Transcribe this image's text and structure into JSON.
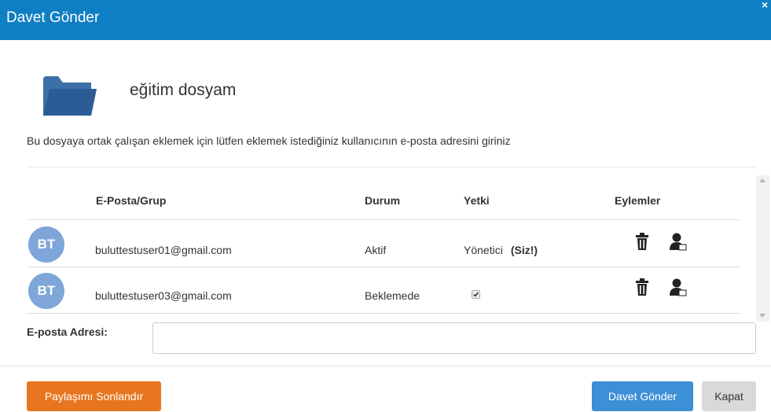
{
  "header": {
    "title": "Davet Gönder",
    "close_glyph": "×"
  },
  "folder": {
    "icon": "folder-icon",
    "name": "eğitim dosyam"
  },
  "instructions": "Bu dosyaya ortak çalışan eklemek için lütfen eklemek istediğiniz kullanıcının e-posta adresini giriniz",
  "table": {
    "columns": {
      "email": "E-Posta/Grup",
      "status": "Durum",
      "permission": "Yetki",
      "actions": "Eylemler"
    },
    "rows": [
      {
        "initials": "BT",
        "email": "buluttestuser01@gmail.com",
        "status": "Aktif",
        "permission": "Yönetici",
        "you_label": "(Siz!)",
        "checkbox": false,
        "actions": [
          "trash-icon",
          "user-permission-icon"
        ]
      },
      {
        "initials": "BT",
        "email": "buluttestuser03@gmail.com",
        "status": "Beklemede",
        "permission": "",
        "checkbox": true,
        "checked": true,
        "actions": [
          "trash-icon",
          "user-permission-icon"
        ]
      }
    ]
  },
  "email_field": {
    "label": "E-posta Adresi:",
    "value": "",
    "placeholder": ""
  },
  "buttons": {
    "end_sharing": "Paylaşımı Sonlandır",
    "send_invite": "Davet Gönder",
    "close": "Kapat"
  },
  "colors": {
    "header": "#0f7fc4",
    "avatar": "#7ea6d8",
    "end_sharing": "#e8761f",
    "send_invite": "#3d8fd6",
    "close": "#d9d9d9",
    "folder": "#2b5c96"
  }
}
